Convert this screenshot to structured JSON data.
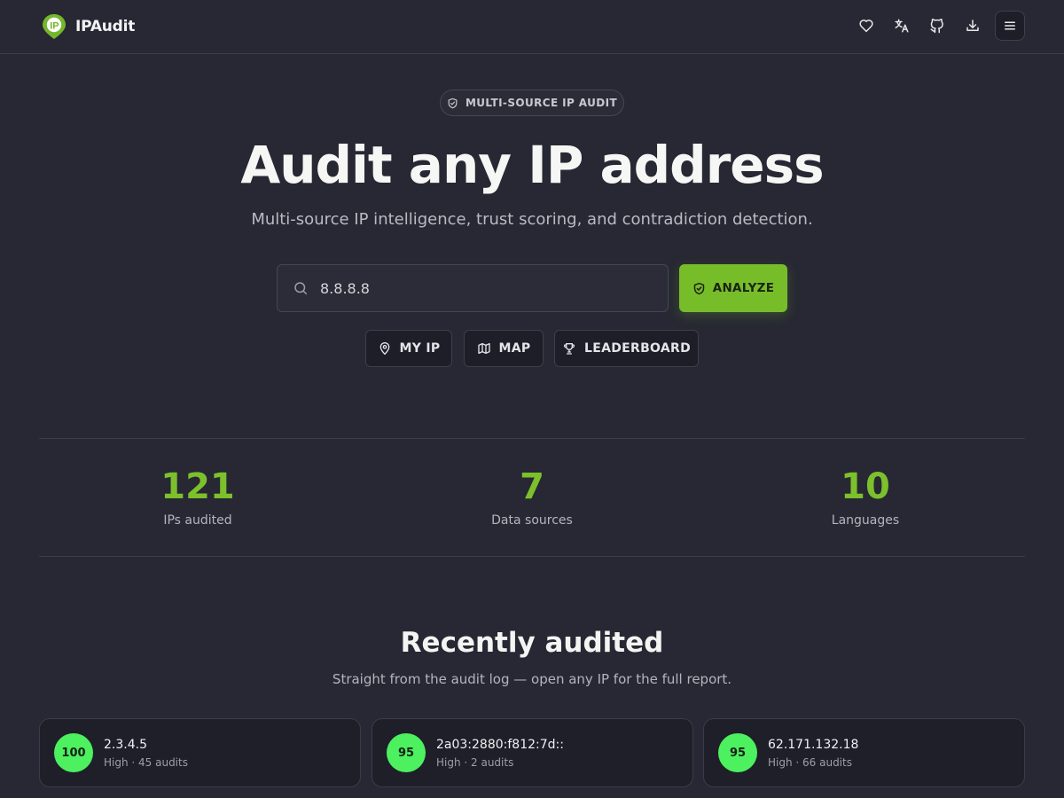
{
  "header": {
    "brand": "IPAudit",
    "icons": [
      "heart-icon",
      "translate-icon",
      "github-icon",
      "download-icon",
      "menu-icon"
    ]
  },
  "hero": {
    "pill": "MULTI-SOURCE IP AUDIT",
    "title": "Audit any IP address",
    "subtitle": "Multi-source IP intelligence, trust scoring, and contradiction detection."
  },
  "search": {
    "value": "8.8.8.8",
    "analyze_label": "ANALYZE"
  },
  "quick_actions": {
    "my_ip": "MY IP",
    "map": "MAP",
    "leaderboard": "LEADERBOARD"
  },
  "stats": [
    {
      "value": "121",
      "label": "IPs audited"
    },
    {
      "value": "7",
      "label": "Data sources"
    },
    {
      "value": "10",
      "label": "Languages"
    }
  ],
  "recent": {
    "title": "Recently audited",
    "subtitle": "Straight from the audit log — open any IP for the full report.",
    "items": [
      {
        "score": "100",
        "ip": "2.3.4.5",
        "meta": "High · 45 audits"
      },
      {
        "score": "95",
        "ip": "2a03:2880:f812:7d::",
        "meta": "High · 2 audits"
      },
      {
        "score": "95",
        "ip": "62.171.132.18",
        "meta": "High · 66 audits"
      }
    ]
  },
  "colors": {
    "background": "#272833",
    "accent": "#77bd2a",
    "stat": "#7cc02c",
    "badge": "#4df05e"
  }
}
